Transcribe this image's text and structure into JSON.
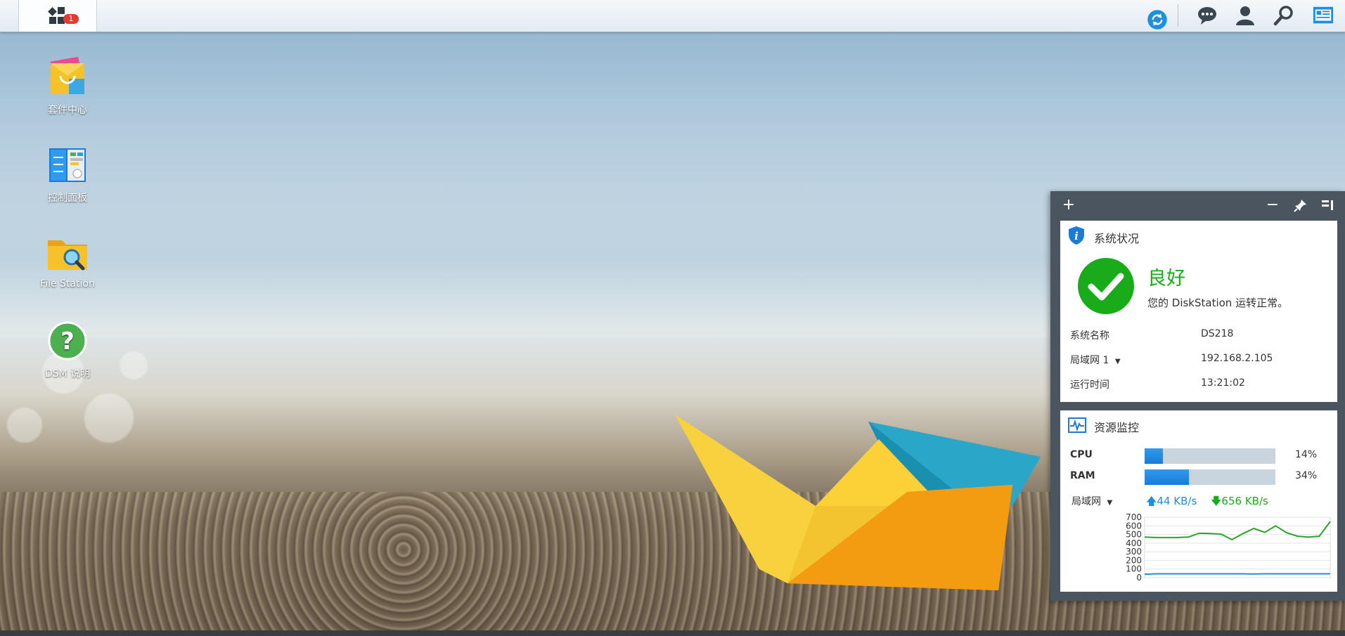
{
  "topbar": {
    "main_menu_badge": "1",
    "icons": [
      "main-menu-icon",
      "sync-icon",
      "notification-icon",
      "user-icon",
      "search-icon",
      "widgets-icon"
    ]
  },
  "desktop": {
    "icons": [
      {
        "label": "套件中心",
        "icon": "package-center-icon"
      },
      {
        "label": "控制面板",
        "icon": "control-panel-icon"
      },
      {
        "label": "File Station",
        "icon": "file-station-icon"
      },
      {
        "label": "DSM 说明",
        "icon": "help-icon"
      }
    ]
  },
  "widgets": {
    "system_health": {
      "title": "系统状况",
      "status": "良好",
      "status_message": "您的 DiskStation 运转正常。",
      "rows": [
        {
          "label": "系统名称",
          "value": "DS218"
        },
        {
          "label": "局域网 1",
          "value": "192.168.2.105"
        },
        {
          "label": "运行时间",
          "value": "13:21:02"
        }
      ]
    },
    "resource_monitor": {
      "title": "资源监控",
      "cpu_label": "CPU",
      "cpu_percent": 14,
      "cpu_text": "14%",
      "ram_label": "RAM",
      "ram_percent": 34,
      "ram_text": "34%",
      "network_label": "局域网",
      "upload": "44 KB/s",
      "download": "656 KB/s"
    }
  },
  "chart_data": {
    "type": "line",
    "ylim": [
      0,
      700
    ],
    "y_ticks": [
      "700",
      "600",
      "500",
      "400",
      "300",
      "200",
      "100",
      "0"
    ],
    "series": [
      {
        "color": "#2aa52a",
        "values": [
          470,
          465,
          465,
          465,
          470,
          515,
          510,
          505,
          440,
          510,
          570,
          525,
          600,
          520,
          480,
          470,
          480,
          650
        ]
      },
      {
        "color": "#1b8fe0",
        "values": [
          40,
          45,
          45,
          45,
          45,
          45,
          45,
          45,
          45,
          45,
          42,
          45,
          45,
          45,
          45,
          45,
          45,
          45
        ]
      }
    ]
  },
  "colors": {
    "accent": "#1b8fe0",
    "ok_green": "#1aab1a",
    "upload_blue": "#1b8fe0",
    "download_green": "#1aab1a"
  }
}
